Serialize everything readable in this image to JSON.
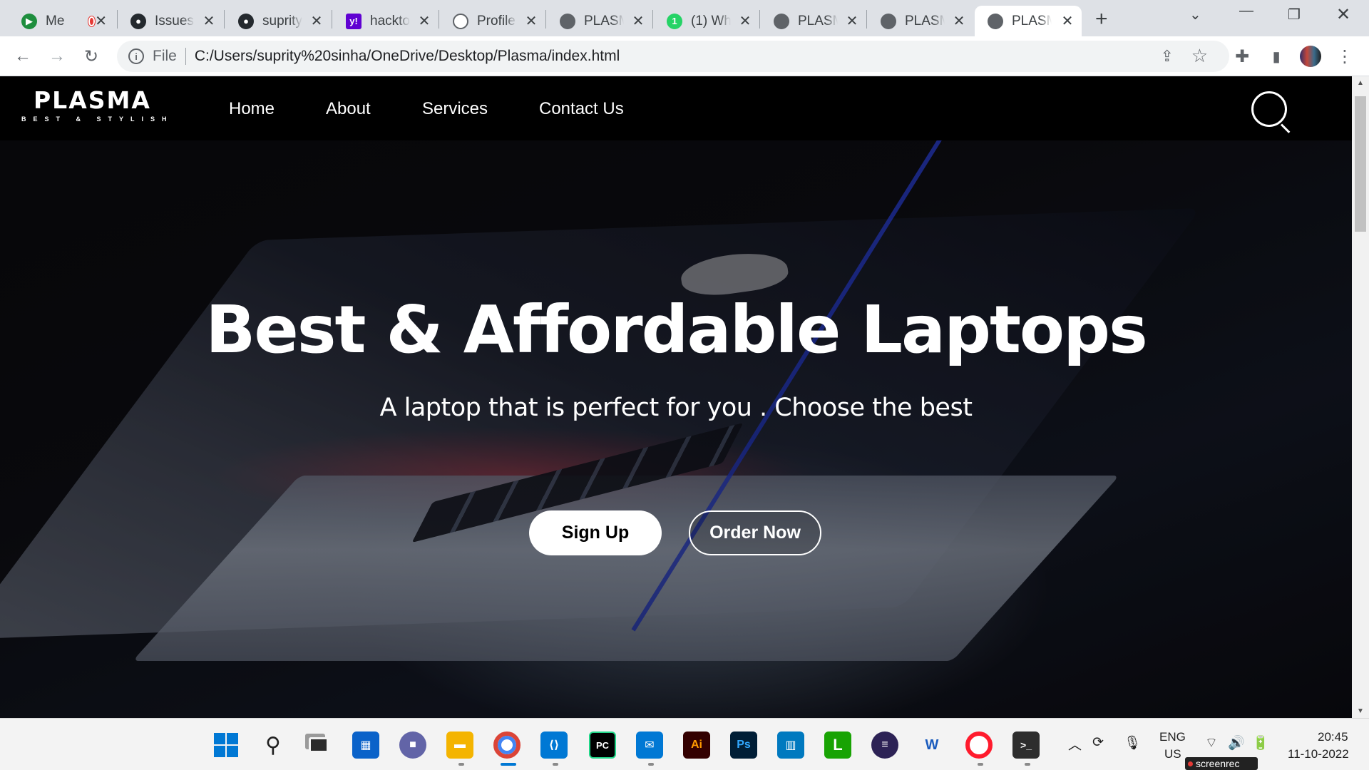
{
  "browser": {
    "tabs": [
      {
        "title": "Me",
        "icon": "google-meet-icon",
        "color": "#1e8e3e"
      },
      {
        "title": "Issues",
        "icon": "github-icon",
        "color": "#24292e"
      },
      {
        "title": "suprity",
        "icon": "github-icon",
        "color": "#24292e"
      },
      {
        "title": "hackto",
        "icon": "yahoo-icon",
        "color": "#6001d2"
      },
      {
        "title": "Profile",
        "icon": "globe-icon",
        "color": "#5f6368"
      },
      {
        "title": "PLASM",
        "icon": "globe-icon",
        "color": "#5f6368"
      },
      {
        "title": "(1) Wh",
        "icon": "whatsapp-icon",
        "color": "#25d366"
      },
      {
        "title": "PLASM",
        "icon": "globe-icon",
        "color": "#5f6368"
      },
      {
        "title": "PLASM",
        "icon": "globe-icon",
        "color": "#5f6368"
      },
      {
        "title": "PLASM",
        "icon": "globe-icon",
        "color": "#5f6368",
        "active": true
      }
    ],
    "address": {
      "scheme_label": "File",
      "url": "C:/Users/suprity%20sinha/OneDrive/Desktop/Plasma/index.html"
    }
  },
  "site": {
    "logo": {
      "name": "PLASMA",
      "tagline": "BEST & STYLISH"
    },
    "nav": [
      "Home",
      "About",
      "Services",
      "Contact Us"
    ],
    "hero": {
      "title": "Best & Affordable Laptops",
      "subtitle": "A laptop that is perfect for you . Choose the best",
      "primary_button": "Sign Up",
      "secondary_button": "Order Now"
    }
  },
  "taskbar": {
    "apps": [
      "windows-start-icon",
      "search-icon",
      "task-view-icon",
      "widgets-icon",
      "teams-chat-icon",
      "file-explorer-icon",
      "chrome-icon",
      "vscode-icon",
      "pycharm-icon",
      "mail-icon",
      "illustrator-icon",
      "photoshop-icon",
      "trello-icon",
      "libreoffice-icon",
      "eclipse-icon",
      "word-icon",
      "opera-icon",
      "terminal-icon"
    ],
    "language_1": "ENG",
    "language_2": "US",
    "time": "20:45",
    "date": "11-10-2022",
    "recorder_label": "screenrec"
  },
  "colors": {
    "page_bg": "#050506",
    "nav_bg": "#000000",
    "accent_red": "#c8141e",
    "laptop_blue": "#2a40d8"
  }
}
